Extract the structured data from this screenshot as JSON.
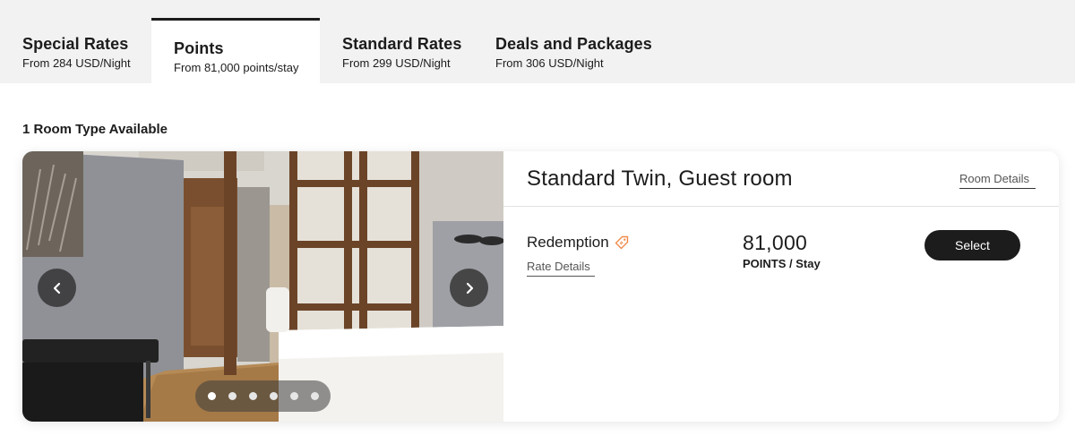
{
  "tabs": [
    {
      "title": "Special Rates",
      "subtitle": "From 284 USD/Night"
    },
    {
      "title": "Points",
      "subtitle": "From 81,000 points/stay"
    },
    {
      "title": "Standard Rates",
      "subtitle": "From 299 USD/Night"
    },
    {
      "title": "Deals and Packages",
      "subtitle": "From 306 USD/Night"
    }
  ],
  "active_tab": "Points",
  "availability": "1 Room Type Available",
  "room": {
    "title": "Standard Twin, Guest room",
    "details_link": "Room Details",
    "carousel": {
      "prev_icon": "chevron-left-icon",
      "next_icon": "chevron-right-icon",
      "slide_count": 6,
      "active_slide": 1
    },
    "rate": {
      "name": "Redemption",
      "tag_icon": "tag-icon",
      "tag_color": "#f08a4b",
      "details_link": "Rate Details",
      "price": "81,000",
      "unit": "POINTS / Stay",
      "select_label": "Select"
    }
  }
}
